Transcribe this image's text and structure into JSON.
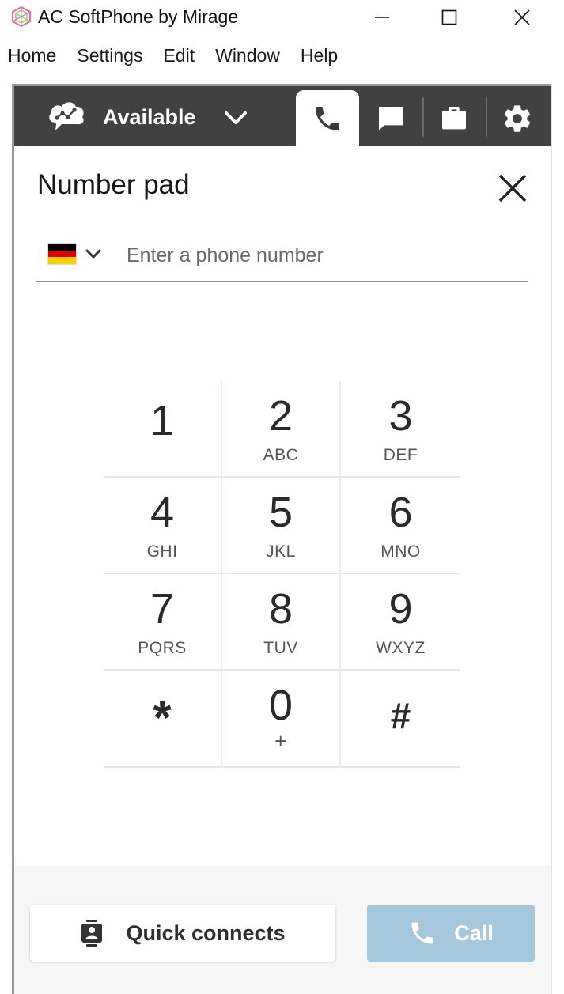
{
  "window": {
    "title": "AC SoftPhone by Mirage"
  },
  "menu": {
    "items": [
      "Home",
      "Settings",
      "Edit",
      "Window",
      "Help"
    ]
  },
  "toolbar": {
    "status": "Available",
    "tabs": [
      {
        "icon": "phone-icon",
        "active": true
      },
      {
        "icon": "chat-icon",
        "active": false
      },
      {
        "icon": "briefcase-icon",
        "active": false
      },
      {
        "icon": "gear-icon",
        "active": false
      }
    ]
  },
  "number_pad": {
    "title": "Number pad",
    "country_flag": "germany-flag-icon",
    "phone_input": {
      "value": "",
      "placeholder": "Enter a phone number"
    },
    "keys": [
      {
        "digit": "1",
        "letters": ""
      },
      {
        "digit": "2",
        "letters": "ABC"
      },
      {
        "digit": "3",
        "letters": "DEF"
      },
      {
        "digit": "4",
        "letters": "GHI"
      },
      {
        "digit": "5",
        "letters": "JKL"
      },
      {
        "digit": "6",
        "letters": "MNO"
      },
      {
        "digit": "7",
        "letters": "PQRS"
      },
      {
        "digit": "8",
        "letters": "TUV"
      },
      {
        "digit": "9",
        "letters": "WXYZ"
      },
      {
        "digit": "*",
        "letters": ""
      },
      {
        "digit": "0",
        "letters": "+"
      },
      {
        "digit": "#",
        "letters": ""
      }
    ]
  },
  "footer": {
    "quick_connects_label": "Quick connects",
    "call_label": "Call"
  },
  "colors": {
    "toolbar_bg": "#414141",
    "call_button_disabled": "#a6c8dc",
    "footer_bg": "#f6f6f6"
  }
}
